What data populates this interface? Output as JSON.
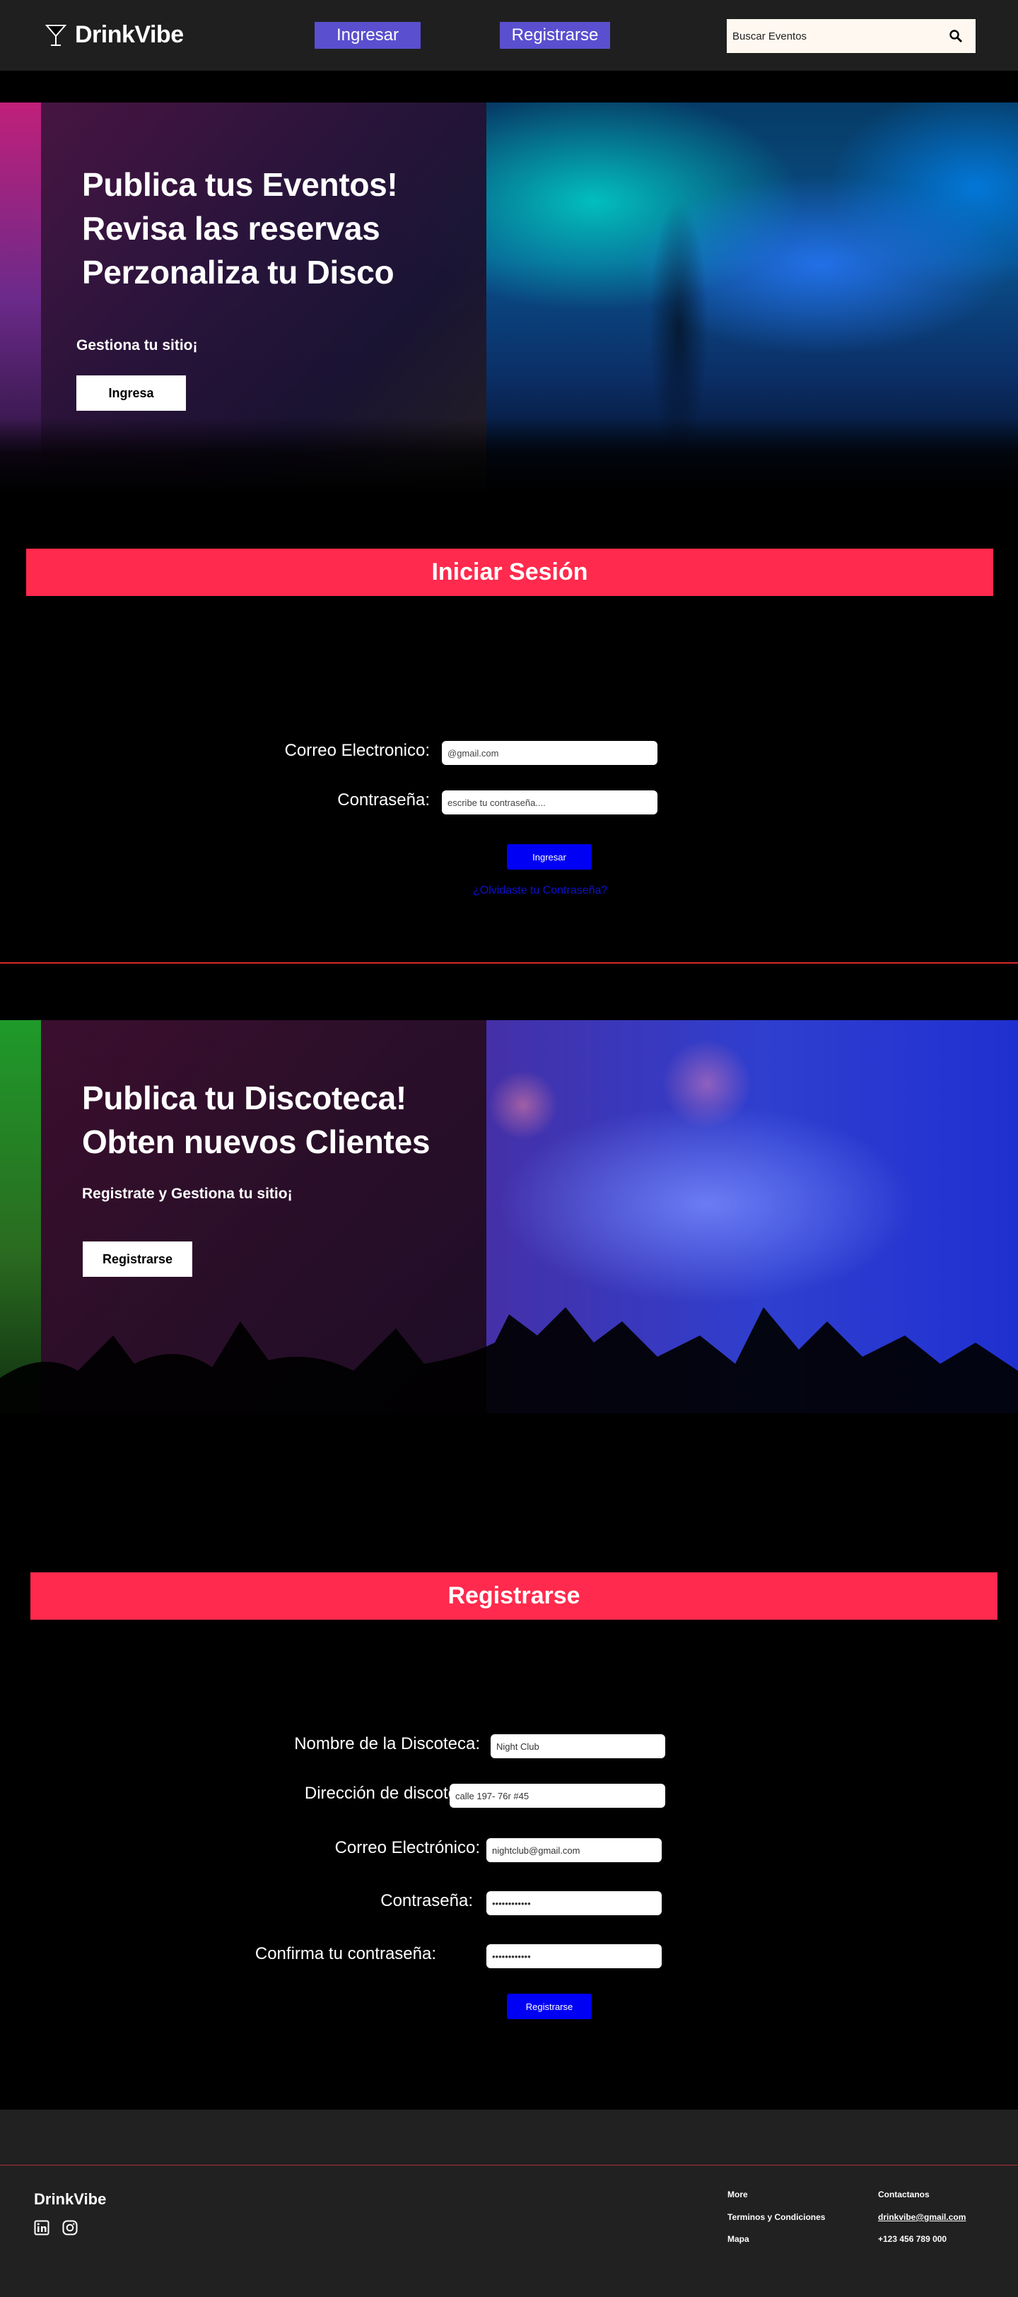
{
  "header": {
    "brand": "DrinkVibe",
    "login_label": "Ingresar",
    "register_label": "Registrarse",
    "search_placeholder": "Buscar Eventos"
  },
  "hero1": {
    "line1": "Publica tus Eventos!",
    "line2": "Revisa las reservas",
    "line3": "Perzonaliza tu Disco",
    "subtitle": "Gestiona tu sitio¡",
    "button": "Ingresa"
  },
  "login": {
    "heading": "Iniciar Sesión",
    "email_label": "Correo Electronico:",
    "email_placeholder": "@gmail.com",
    "password_label": "Contraseña:",
    "password_placeholder": "escribe tu contraseña....",
    "submit": "Ingresar",
    "forgot": "¿Olvidaste tu Contraseña?"
  },
  "hero2": {
    "line1": "Publica tu Discoteca!",
    "line2": "Obten nuevos Clientes",
    "subtitle": "Registrate y Gestiona tu sitio¡",
    "button": "Registrarse"
  },
  "register": {
    "heading": "Registrarse",
    "club_label": "Nombre de la Discoteca:",
    "club_value": "Night Club",
    "address_label": "Dirección de discoteca:",
    "address_value": "calle 197- 76r #45",
    "email_label": "Correo Electrónico:",
    "email_value": "nightclub@gmail.com",
    "password_label": "Contraseña:",
    "password_value": "••••••••••••",
    "confirm_label": "Confirma tu contraseña:",
    "confirm_value": "••••••••••••",
    "submit": "Registrarse"
  },
  "footer": {
    "brand": "DrinkVibe",
    "more_heading": "More",
    "more_items": [
      "Terminos y Condiciones",
      "Mapa"
    ],
    "contact_heading": "Contactanos",
    "contact_email": "drinkvibe@gmail.com",
    "contact_phone": "+123 456 789 000"
  },
  "colors": {
    "accent_red": "#ff2a4d",
    "nav_button": "#5a4fcf",
    "submit_blue": "#0000f5",
    "header_bg": "#1f1f1f"
  }
}
